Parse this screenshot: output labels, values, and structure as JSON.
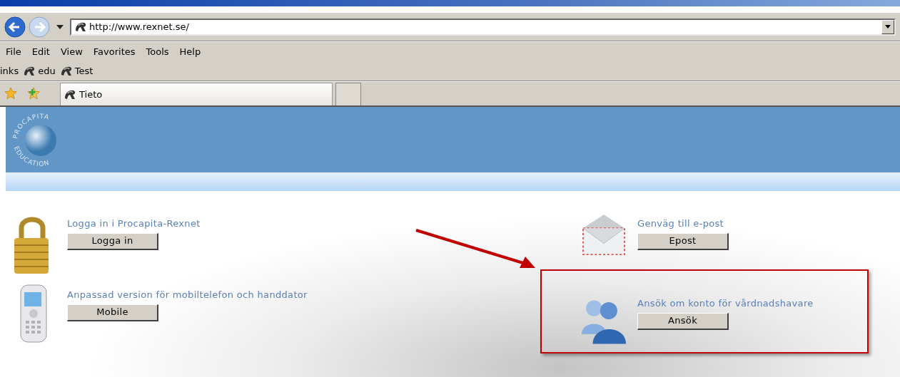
{
  "browser": {
    "address": "http://www.rexnet.se/",
    "menu": [
      "File",
      "Edit",
      "View",
      "Favorites",
      "Tools",
      "Help"
    ],
    "links_label": "inks",
    "links": [
      "edu",
      "Test"
    ],
    "tabs": [
      {
        "label": "Tieto",
        "selected": true
      }
    ]
  },
  "page": {
    "logo": {
      "top": "PROCAPITA",
      "bottom": "EDUCATION"
    },
    "columns": [
      [
        {
          "kind": "lock",
          "caption": "Logga in i Procapita-Rexnet",
          "button": "Logga in",
          "highlighted": false
        },
        {
          "kind": "phone",
          "caption": "Anpassad version för mobiltelefon och handdator",
          "button": "Mobile",
          "highlighted": false
        }
      ],
      [
        {
          "kind": "mail",
          "caption": "Genväg till e-post",
          "button": "Epost",
          "highlighted": false
        },
        {
          "kind": "people",
          "caption": "Ansök om konto för vårdnadshavare",
          "button": "Ansök",
          "highlighted": true
        }
      ]
    ]
  }
}
